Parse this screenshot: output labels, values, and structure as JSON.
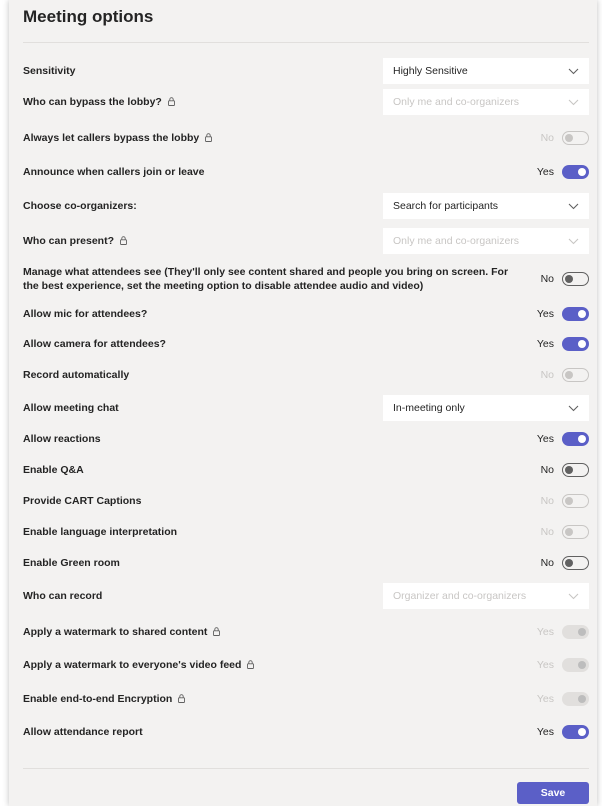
{
  "title": "Meeting options",
  "save_label": "Save",
  "options": {
    "sensitivity": {
      "label": "Sensitivity",
      "value": "Highly Sensitive"
    },
    "bypass_lobby": {
      "label": "Who can bypass the lobby?",
      "value": "Only me and co-organizers"
    },
    "callers_bypass": {
      "label": "Always let callers bypass the lobby",
      "state": "No"
    },
    "announce_callers": {
      "label": "Announce when callers join or leave",
      "state": "Yes"
    },
    "co_organizers": {
      "label": "Choose co-organizers:",
      "placeholder": "Search for participants"
    },
    "who_can_present": {
      "label": "Who can present?",
      "value": "Only me and co-organizers"
    },
    "manage_attendees": {
      "label": "Manage what attendees see (They'll only see content shared and people you bring on screen. For the best experience, set the meeting option to disable attendee audio and video)",
      "state": "No"
    },
    "mic_attendees": {
      "label": "Allow mic for attendees?",
      "state": "Yes"
    },
    "camera_attendees": {
      "label": "Allow camera for attendees?",
      "state": "Yes"
    },
    "record_auto": {
      "label": "Record automatically",
      "state": "No"
    },
    "meeting_chat": {
      "label": "Allow meeting chat",
      "value": "In-meeting only"
    },
    "reactions": {
      "label": "Allow reactions",
      "state": "Yes"
    },
    "qa": {
      "label": "Enable Q&A",
      "state": "No"
    },
    "cart_captions": {
      "label": "Provide CART Captions",
      "state": "No"
    },
    "language_interp": {
      "label": "Enable language interpretation",
      "state": "No"
    },
    "green_room": {
      "label": "Enable Green room",
      "state": "No"
    },
    "who_can_record": {
      "label": "Who can record",
      "value": "Organizer and co-organizers"
    },
    "watermark_content": {
      "label": "Apply a watermark to shared content",
      "state": "Yes"
    },
    "watermark_video": {
      "label": "Apply a watermark to everyone's video feed",
      "state": "Yes"
    },
    "e2e_encryption": {
      "label": "Enable end-to-end Encryption",
      "state": "Yes"
    },
    "attendance_report": {
      "label": "Allow attendance report",
      "state": "Yes"
    }
  },
  "colors": {
    "accent": "#5b5fc7",
    "disabled_text": "#c8c6c4",
    "background": "#f3f2f1"
  },
  "icons": {
    "lock": "lock-icon",
    "chevron": "chevron-down-icon"
  }
}
